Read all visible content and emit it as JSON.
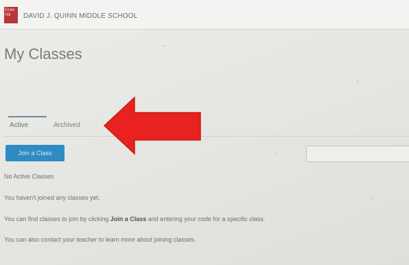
{
  "header": {
    "logo_text": "Graw Hill",
    "school_name": "DAVID J. QUINN MIDDLE SCHOOL"
  },
  "page": {
    "title": "My Classes"
  },
  "tabs": [
    {
      "label": "Active",
      "selected": true
    },
    {
      "label": "Archived",
      "selected": false
    }
  ],
  "actions": {
    "join_label": "Join a Class",
    "search_placeholder": ""
  },
  "messages": {
    "no_active": "No Active Classes",
    "not_joined": "You haven't joined any classes yet.",
    "find_prefix": "You can find classes to join by clicking ",
    "find_bold": "Join a Class",
    "find_suffix": " and entering your code for a specific class.",
    "contact": "You can also contact your teacher to learn more about joining classes."
  },
  "annotation": {
    "arrow_icon": "red-left-arrow-icon",
    "arrow_color": "#e8221f"
  },
  "colors": {
    "button": "#2f8bc3",
    "logo": "#b8353a",
    "tab_indicator": "#6f87a3"
  }
}
